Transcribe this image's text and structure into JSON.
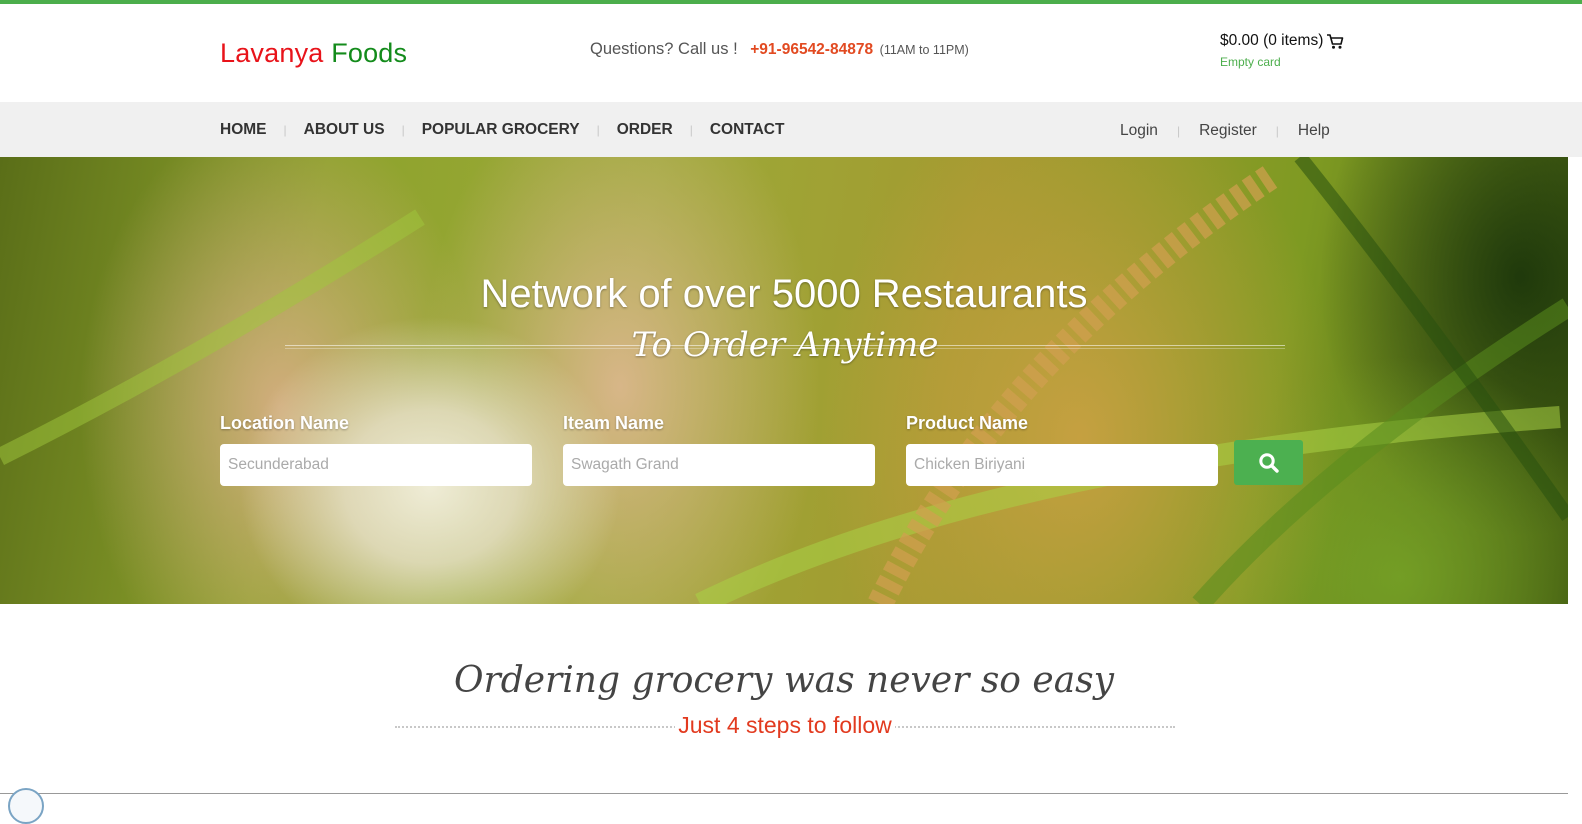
{
  "brand": {
    "name_part1": "Lavanya",
    "name_part2": "Foods"
  },
  "contact": {
    "prompt": "Questions? Call us !",
    "phone": "+91-96542-84878",
    "hours": "(11AM to 11PM)"
  },
  "cart": {
    "summary": "$0.00 (0 items)",
    "status": "Empty card",
    "icon": "cart-icon"
  },
  "nav": {
    "items": [
      {
        "label": "HOME"
      },
      {
        "label": "ABOUT US"
      },
      {
        "label": "POPULAR GROCERY"
      },
      {
        "label": "ORDER"
      },
      {
        "label": "CONTACT"
      }
    ],
    "account_links": [
      {
        "label": "Login"
      },
      {
        "label": "Register"
      },
      {
        "label": "Help"
      }
    ]
  },
  "hero": {
    "title": "Network of over 5000 Restaurants",
    "subtitle": "To Order Anytime",
    "search": {
      "location": {
        "label": "Location Name",
        "placeholder": "Secunderabad"
      },
      "item": {
        "label": "Iteam Name",
        "placeholder": "Swagath Grand"
      },
      "product": {
        "label": "Product Name",
        "placeholder": "Chicken Biriyani"
      },
      "button_icon": "search-icon"
    }
  },
  "steps": {
    "title": "Ordering grocery was never so easy",
    "subtitle": "Just 4 steps to follow"
  },
  "colors": {
    "accent_green": "#4cae4c",
    "logo_red": "#e8131a",
    "logo_green": "#138b1b",
    "phone_orange": "#e24a21",
    "steps_red": "#e23a1f"
  }
}
